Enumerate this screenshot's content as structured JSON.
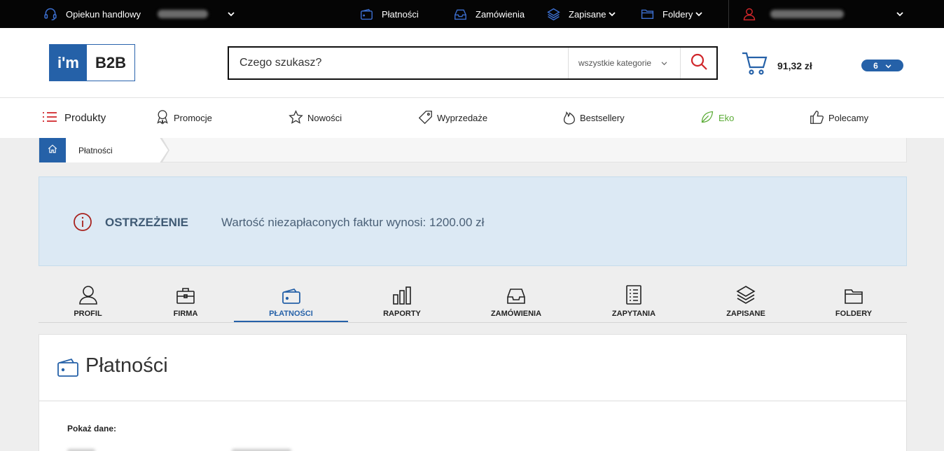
{
  "topbar": {
    "advisor_label": "Opiekun handlowy",
    "advisor_phone_hidden": "",
    "links": [
      {
        "label": "Płatności",
        "icon": "wallet-icon"
      },
      {
        "label": "Zamówienia",
        "icon": "inbox-icon"
      },
      {
        "label": "Zapisane",
        "icon": "layers-icon"
      },
      {
        "label": "Foldery",
        "icon": "folder-icon"
      }
    ],
    "user_icon": "user-icon"
  },
  "header": {
    "logo_mark": "i'm",
    "logo_text": "B2B",
    "search_placeholder": "Czego szukasz?",
    "search_category": "wszystkie kategorie",
    "cart_total": "91,32 zł",
    "cart_count": "6"
  },
  "catnav": {
    "items": [
      {
        "label": "Produkty",
        "icon": "list-icon"
      },
      {
        "label": "Promocje",
        "icon": "award-icon"
      },
      {
        "label": "Nowości",
        "icon": "star-icon"
      },
      {
        "label": "Wyprzedaże",
        "icon": "tag-icon"
      },
      {
        "label": "Bestsellery",
        "icon": "flame-icon"
      },
      {
        "label": "Eko",
        "icon": "leaf-icon"
      },
      {
        "label": "Polecamy",
        "icon": "thumbs-up-icon"
      }
    ]
  },
  "breadcrumb": {
    "items": [
      "Płatności"
    ]
  },
  "alert": {
    "title": "OSTRZEŻENIE",
    "message": "Wartość niezapłaconych faktur wynosi: 1200.00 zł"
  },
  "account_tabs": {
    "active": "PŁATNOŚCI",
    "items": [
      {
        "label": "PROFIL",
        "icon": "user-icon"
      },
      {
        "label": "FIRMA",
        "icon": "briefcase-icon"
      },
      {
        "label": "PŁATNOŚCI",
        "icon": "wallet-icon"
      },
      {
        "label": "RAPORTY",
        "icon": "bar-chart-icon"
      },
      {
        "label": "ZAMÓWIENIA",
        "icon": "inbox-icon"
      },
      {
        "label": "ZAPYTANIA",
        "icon": "document-list-icon"
      },
      {
        "label": "ZAPISANE",
        "icon": "layers-icon"
      },
      {
        "label": "FOLDERY",
        "icon": "folder-icon"
      }
    ]
  },
  "panel": {
    "title": "Płatności",
    "show_data_label": "Pokaż dane:"
  },
  "colors": {
    "brand_blue": "#2561a8",
    "alert_bg": "#dce9f4",
    "danger_red": "#d0262a",
    "eko_green": "#5aab35"
  }
}
